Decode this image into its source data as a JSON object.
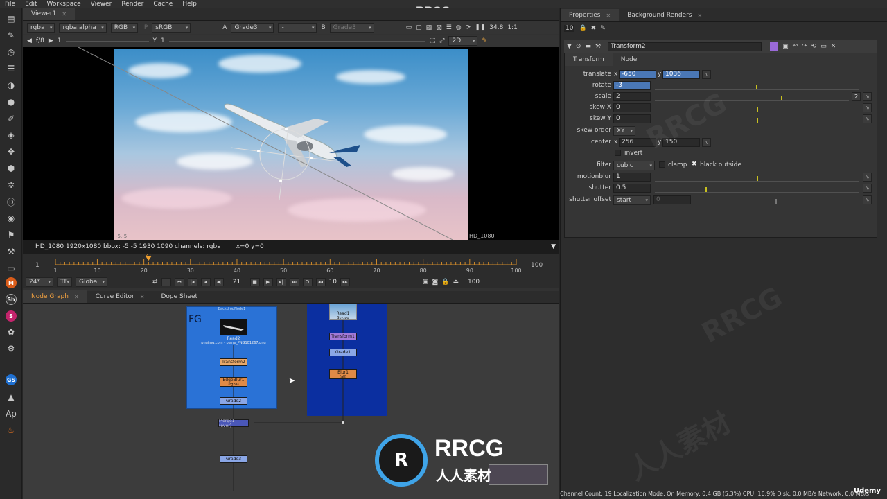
{
  "watermark_top": "RRCG.cn",
  "menubar": [
    "File",
    "Edit",
    "Workspace",
    "Viewer",
    "Render",
    "Cache",
    "Help"
  ],
  "viewer": {
    "tab": "Viewer1",
    "channels": "rgba",
    "alpha": "rgba.alpha",
    "display": "RGB",
    "ip_label": "IP",
    "colorspace": "sRGB",
    "a_label": "A",
    "a_input": "Grade3",
    "dash": "-",
    "b_label": "B",
    "b_input": "Grade3",
    "zoom": "34.8",
    "ratio": "1:1",
    "fstop": "f/8",
    "frame_gain": "1",
    "y_label": "Y",
    "y_value": "1",
    "mode": "2D",
    "corner_label_bl": "-5,-5",
    "corner_label_br": "HD_1080",
    "info": "HD_1080 1920x1080  bbox: -5 -5 1930 1090 channels: rgba",
    "cursor": "x=0 y=0"
  },
  "timeline": {
    "ticks": [
      "1",
      "10",
      "20",
      "30",
      "40",
      "50",
      "60",
      "70",
      "80",
      "90",
      "100"
    ],
    "start": "1",
    "end": "100",
    "current": "21",
    "fps": "24*",
    "tf": "TF",
    "global": "Global",
    "frame_field": "21",
    "increment": "10",
    "end_field": "100"
  },
  "graph_tabs": [
    "Node Graph",
    "Curve Editor",
    "Dope Sheet"
  ],
  "nodes": {
    "backdrop_title": "BackdropNode1",
    "fg": "FG",
    "read2": "Read2",
    "read2_file": "pngimg.com - plane_PNG101267.png",
    "transform2": "Transform2",
    "edgeblur1": "EdgeBlur1",
    "edgeblur1_sub": "(rgba)",
    "grade2": "Grade2",
    "merge1": "Merge1 (over)",
    "grade3": "Grade3",
    "read1": "Read1",
    "read1_file": "Sky.jpg",
    "transform1": "Transform1",
    "grade1": "Grade1",
    "blur1": "Blur1",
    "blur1_sub": "(all)"
  },
  "properties": {
    "tabs": [
      "Properties",
      "Background Renders"
    ],
    "max_panels": "10",
    "node_name": "Transform2",
    "subtabs": [
      "Transform",
      "Node"
    ],
    "translate_label": "translate",
    "translate_x_lbl": "x",
    "translate_x": "-650",
    "translate_y_lbl": "y",
    "translate_y": "1036",
    "rotate_label": "rotate",
    "rotate": "-3",
    "scale_label": "scale",
    "scale": "2",
    "scale_badge": "2",
    "skewx_label": "skew X",
    "skewx": "0",
    "skewy_label": "skew Y",
    "skewy": "0",
    "skeworder_label": "skew order",
    "skeworder": "XY",
    "center_label": "center",
    "center_x_lbl": "x",
    "center_x": "256",
    "center_y_lbl": "y",
    "center_y": "150",
    "invert_label": "invert",
    "filter_label": "filter",
    "filter": "cubic",
    "clamp_label": "clamp",
    "black_outside_label": "black outside",
    "motionblur_label": "motionblur",
    "motionblur": "1",
    "shutter_label": "shutter",
    "shutter": "0.5",
    "shutteroffset_label": "shutter offset",
    "shutteroffset": "start",
    "shutteroffset_val": "0"
  },
  "status": "Channel Count: 19  Localization Mode: On  Memory: 0.4 GB (5.3%)  CPU: 16.9%  Disk: 0.0 MB/s  Network: 0.0 MB/s",
  "logo": {
    "main": "RRCG",
    "sub": "人人素材"
  },
  "corner_brand": "Udemy"
}
